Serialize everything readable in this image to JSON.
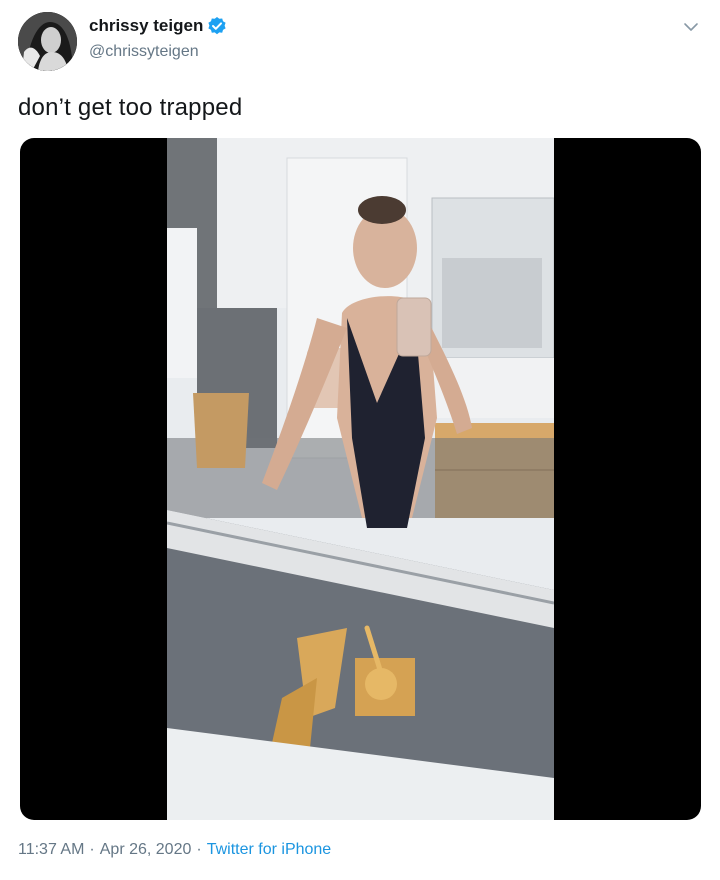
{
  "tweet": {
    "author": {
      "display_name": "chrissy teigen",
      "handle": "@chrissyteigen",
      "verified": true
    },
    "text": "don’t get too trapped",
    "media": {
      "type": "video"
    },
    "meta": {
      "time": "11:37 AM",
      "separator": "·",
      "date": "Apr 26, 2020",
      "source": "Twitter for iPhone"
    }
  },
  "icons": {
    "verified": "verified-badge-icon",
    "menu": "chevron-down-icon"
  },
  "colors": {
    "verified_blue": "#1da1f2",
    "link_blue": "#1b95e0",
    "secondary_text": "#657786",
    "primary_text": "#14171a"
  }
}
